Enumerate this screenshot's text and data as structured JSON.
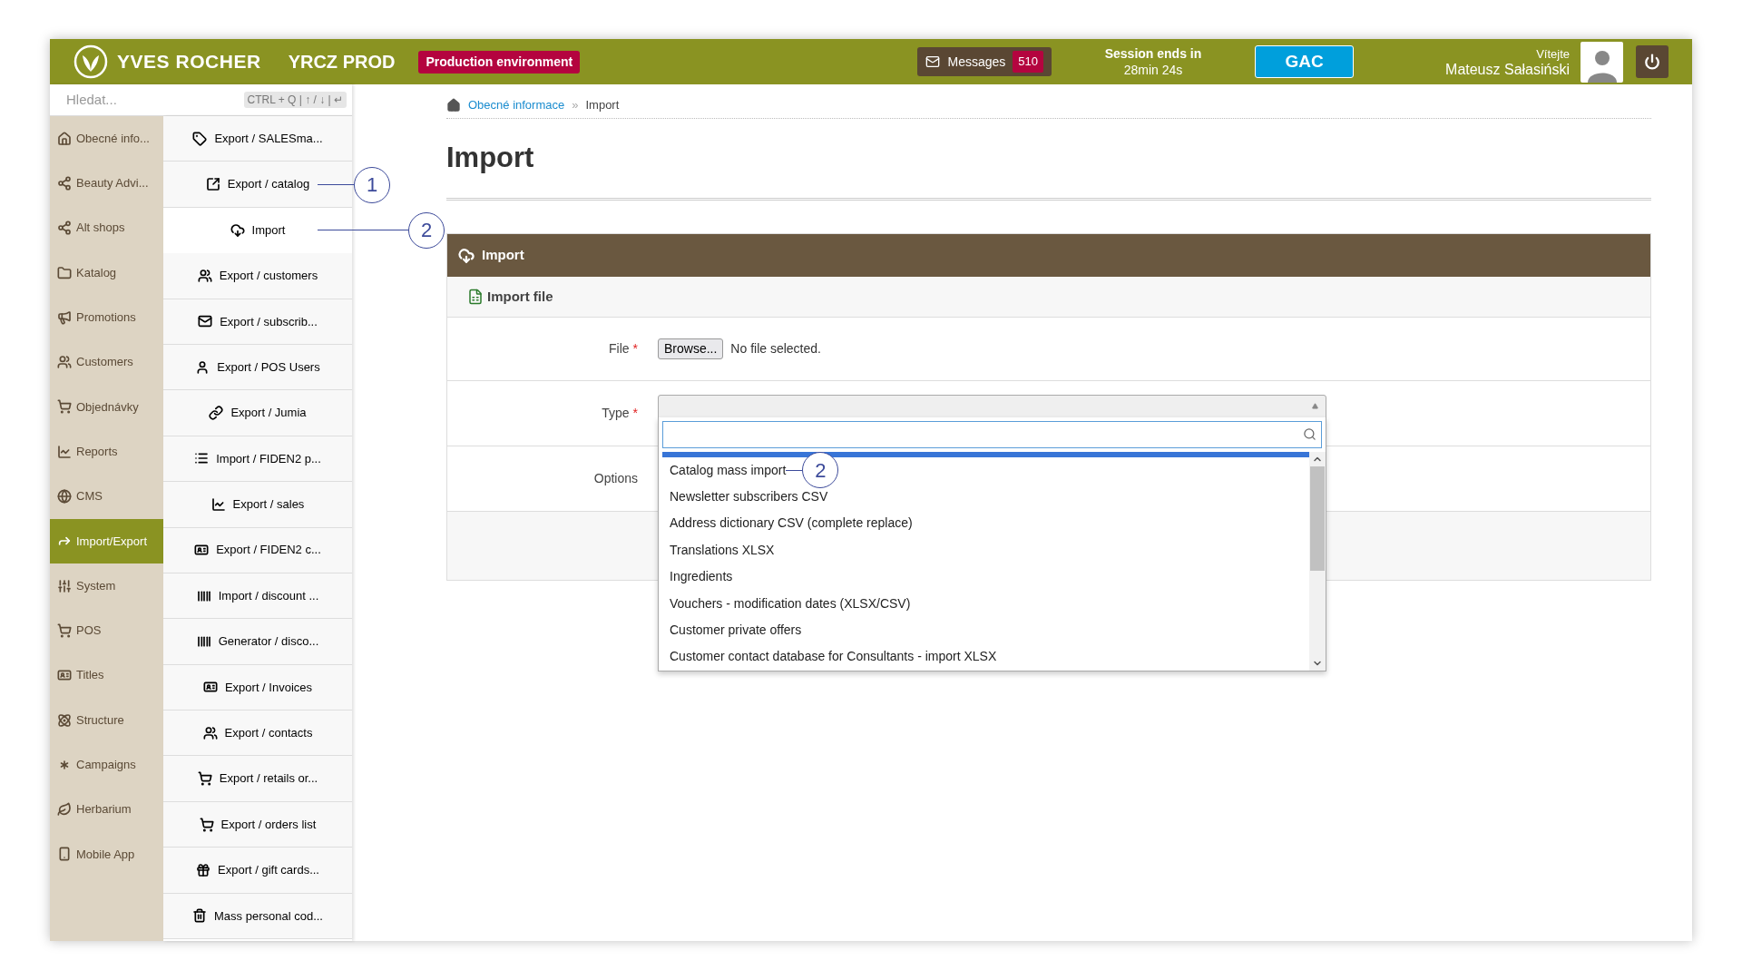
{
  "header": {
    "brand": "YVES ROCHER",
    "instance": "YRCZ PROD",
    "environment": "Production environment",
    "messages": {
      "label": "Messages",
      "count": "510"
    },
    "session": {
      "label": "Session ends in",
      "time": "28min 24s"
    },
    "gac_button": "GAC",
    "welcome": "Vítejte",
    "user_name": "Mateusz Sałasiński"
  },
  "search": {
    "placeholder": "Hledat...",
    "shortcut": "CTRL + Q | ↑ / ↓ | ↵"
  },
  "main_nav": [
    {
      "label": "Obecné info...",
      "selected": false
    },
    {
      "label": "Beauty Advi...",
      "selected": false
    },
    {
      "label": "Alt shops",
      "selected": false
    },
    {
      "label": "Katalog",
      "selected": false
    },
    {
      "label": "Promotions",
      "selected": false
    },
    {
      "label": "Customers",
      "selected": false
    },
    {
      "label": "Objednávky",
      "selected": false
    },
    {
      "label": "Reports",
      "selected": false
    },
    {
      "label": "CMS",
      "selected": false
    },
    {
      "label": "Import/Export",
      "selected": true
    },
    {
      "label": "System",
      "selected": false
    },
    {
      "label": "POS",
      "selected": false
    },
    {
      "label": "Titles",
      "selected": false
    },
    {
      "label": "Structure",
      "selected": false
    },
    {
      "label": "Campaigns",
      "selected": false
    },
    {
      "label": "Herbarium",
      "selected": false
    },
    {
      "label": "Mobile App",
      "selected": false
    }
  ],
  "sub_nav": [
    {
      "label": "Export / SALESma...",
      "selected": false
    },
    {
      "label": "Export / catalog",
      "selected": false,
      "callout": "1"
    },
    {
      "label": "Import",
      "selected": true,
      "callout": "2"
    },
    {
      "label": "Export / customers",
      "selected": false
    },
    {
      "label": "Export / subscrib...",
      "selected": false
    },
    {
      "label": "Export / POS Users",
      "selected": false
    },
    {
      "label": "Export / Jumia",
      "selected": false
    },
    {
      "label": "Import / FIDEN2 p...",
      "selected": false
    },
    {
      "label": "Export / sales",
      "selected": false
    },
    {
      "label": "Export / FIDEN2 c...",
      "selected": false
    },
    {
      "label": "Import / discount ...",
      "selected": false
    },
    {
      "label": "Generator / disco...",
      "selected": false
    },
    {
      "label": "Export / Invoices",
      "selected": false
    },
    {
      "label": "Export / contacts",
      "selected": false
    },
    {
      "label": "Export / retails or...",
      "selected": false
    },
    {
      "label": "Export / orders list",
      "selected": false
    },
    {
      "label": "Export / gift cards...",
      "selected": false
    },
    {
      "label": "Mass personal cod...",
      "selected": false
    }
  ],
  "breadcrumbs": {
    "separator": "»",
    "items": [
      "Obecné informace",
      "Import"
    ]
  },
  "required_symbol": "*",
  "page_title": "Import",
  "panel": {
    "title": "Import",
    "section": "Import file",
    "fields": [
      {
        "kind": "file",
        "label": "File",
        "required": true,
        "button": "Browse...",
        "value": "No file selected."
      },
      {
        "kind": "select",
        "label": "Type",
        "required": true,
        "expanded": true
      },
      {
        "kind": "options",
        "label": "Options",
        "required": false
      }
    ]
  },
  "type_dropdown": {
    "options": [
      {
        "label": "Catalog mass import",
        "callout": "2"
      },
      {
        "label": "Newsletter subscribers CSV"
      },
      {
        "label": "Address dictionary CSV (complete replace)"
      },
      {
        "label": "Translations XLSX"
      },
      {
        "label": "Ingredients"
      },
      {
        "label": "Vouchers - modification dates (XLSX/CSV)"
      },
      {
        "label": "Customer private offers"
      },
      {
        "label": "Customer contact database for Consultants - import XLSX"
      }
    ]
  }
}
